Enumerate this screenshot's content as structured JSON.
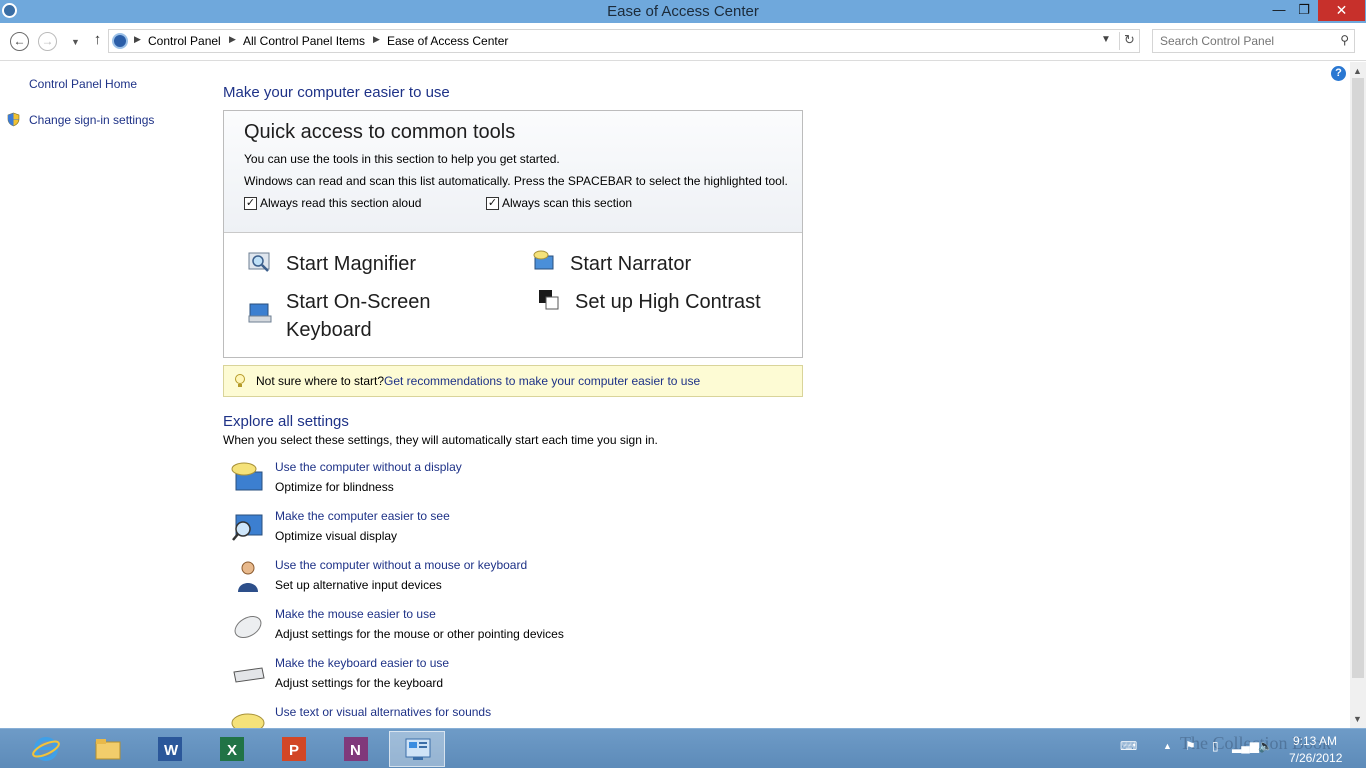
{
  "window": {
    "title": "Ease of Access Center",
    "minimize": "—",
    "maximize": "❐",
    "close": "✕"
  },
  "address": {
    "breadcrumb": [
      "Control Panel",
      "All Control Panel Items",
      "Ease of Access Center"
    ],
    "search_placeholder": "Search Control Panel"
  },
  "sidebar": {
    "home_label": "Control Panel Home",
    "signin_label": "Change sign-in settings"
  },
  "main": {
    "heading": "Make your computer easier to use",
    "quick": {
      "title": "Quick access to common tools",
      "line1": "You can use the tools in this section to help you get started.",
      "line2": "Windows can read and scan this list automatically.  Press the SPACEBAR to select the highlighted tool.",
      "checkbox_read": {
        "label": "Always read this section aloud",
        "checked": true
      },
      "checkbox_scan": {
        "label": "Always scan this section",
        "checked": true
      },
      "tools": {
        "magnifier": "Start Magnifier",
        "narrator": "Start Narrator",
        "keyboard_l1": "Start On-Screen",
        "keyboard_l2": "Keyboard",
        "contrast": "Set up High Contrast"
      }
    },
    "tip": {
      "text": "Not sure where to start?",
      "link": "Get recommendations to make your computer easier to use"
    },
    "explore": {
      "heading": "Explore all settings",
      "description": "When you select these settings, they will automatically start each time you sign in.",
      "items": [
        {
          "link": "Use the computer without a display",
          "desc": "Optimize for blindness",
          "icon": "display-speech-icon"
        },
        {
          "link": "Make the computer easier to see",
          "desc": "Optimize visual display",
          "icon": "magnifier-monitor-icon"
        },
        {
          "link": "Use the computer without a mouse or keyboard",
          "desc": "Set up alternative input devices",
          "icon": "person-icon"
        },
        {
          "link": "Make the mouse easier to use",
          "desc": "Adjust settings for the mouse or other pointing devices",
          "icon": "mouse-icon"
        },
        {
          "link": "Make the keyboard easier to use",
          "desc": "Adjust settings for the keyboard",
          "icon": "keyboard-icon"
        },
        {
          "link": "Use text or visual alternatives for sounds",
          "desc": "",
          "icon": "speech-bubble-icon"
        }
      ]
    }
  },
  "taskbar": {
    "apps": [
      "internet-explorer-icon",
      "file-explorer-icon",
      "word-icon",
      "excel-icon",
      "powerpoint-icon",
      "onenote-icon",
      "control-panel-icon"
    ],
    "clock_time": "9:13 AM",
    "clock_date": "7/26/2012",
    "watermark": "The Collection Book"
  }
}
